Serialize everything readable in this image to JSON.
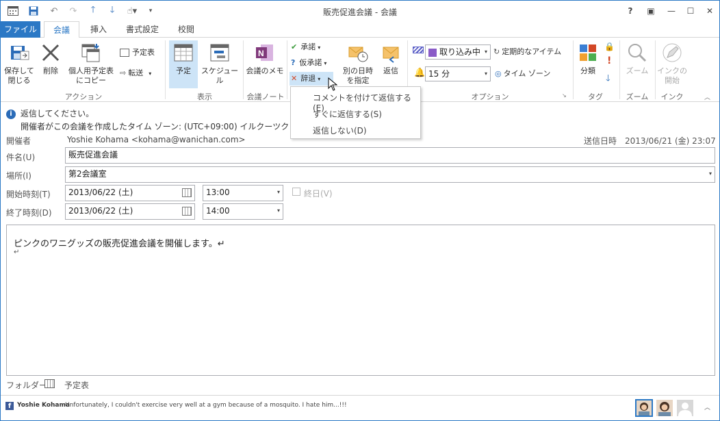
{
  "window": {
    "title": "販売促進会議 - 会議"
  },
  "title_controls": {
    "help": "?",
    "ribbon_display": "▣",
    "minimize": "—",
    "maximize": "☐",
    "close": "✕"
  },
  "tabs": [
    {
      "label": "ファイル"
    },
    {
      "label": "会議"
    },
    {
      "label": "挿入"
    },
    {
      "label": "書式設定"
    },
    {
      "label": "校閲"
    }
  ],
  "ribbon": {
    "actions": {
      "save_close": "保存して\n閉じる",
      "delete": "削除",
      "copy_personal": "個人用予定表\nにコピー",
      "calendar": "予定表",
      "forward": "転送",
      "label": "アクション"
    },
    "show": {
      "appointment": "予定",
      "schedule": "スケジュール",
      "label": "表示"
    },
    "notes": {
      "meeting_notes": "会議のメモ",
      "label": "会議ノート"
    },
    "respond": {
      "accept": "承諾",
      "tentative": "仮承諾",
      "decline": "辞退",
      "propose": "別の日時\nを指定",
      "reply": "返信"
    },
    "options": {
      "show_as": "取り込み中",
      "recurrence": "定期的なアイテム",
      "reminder": "15 分",
      "time_zone": "タイム ゾーン",
      "label": "オプション"
    },
    "tags": {
      "categorize": "分類",
      "label": "タグ"
    },
    "zoom": {
      "zoom": "ズーム",
      "label": "ズーム"
    },
    "ink": {
      "start": "インクの\n開始",
      "label": "インク"
    }
  },
  "decline_menu": {
    "items": [
      "コメントを付けて返信する(E)",
      "すぐに返信する(S)",
      "返信しない(D)"
    ]
  },
  "info": {
    "line1": "返信してください。",
    "line2": "開催者がこの会議を作成したタイム ゾーン: (UTC+09:00) イルクーツク"
  },
  "form": {
    "organizer_label": "開催者",
    "organizer": "Yoshie Kohama <kohama@wanichan.com>",
    "sent_label": "送信日時",
    "sent": "2013/06/21 (金) 23:07",
    "subject_label": "件名(U)",
    "subject": "販売促進会議",
    "location_label": "場所(I)",
    "location": "第2会議室",
    "start_label": "開始時刻(T)",
    "start_date": "2013/06/22 (土)",
    "start_time": "13:00",
    "allday_label": "終日(V)",
    "end_label": "終了時刻(D)",
    "end_date": "2013/06/22 (土)",
    "end_time": "14:00"
  },
  "body": {
    "line1": "ピンクのワニグッズの販売促進会議を開催します。↵",
    "line2": "↵"
  },
  "folder": {
    "label": "フォルダー",
    "value": "予定表"
  },
  "social": {
    "name": "Yoshie Kohama",
    "message": "Unfortunately, I couldn't exercise very well at a gym because of a mosquito. I hate him...!!!"
  },
  "colors": {
    "accent": "#2b78c5",
    "selected": "#cde4f7",
    "decline_x": "#d24726",
    "accept_check": "#3a9a3a"
  }
}
